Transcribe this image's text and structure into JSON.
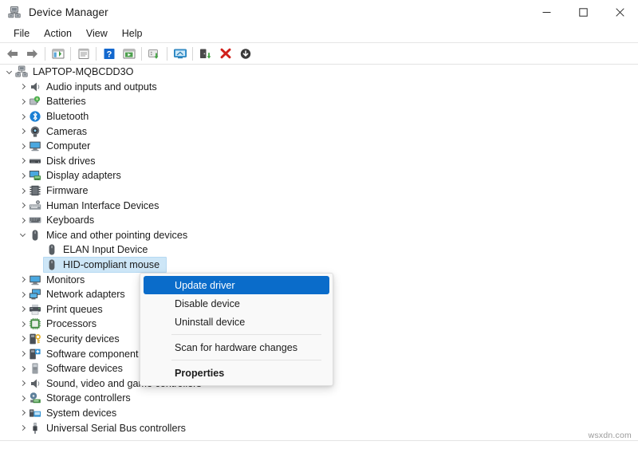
{
  "window": {
    "title": "Device Manager",
    "icon": "device-manager-icon",
    "minimize_label": "–",
    "maximize_label": "☐",
    "close_label": "✕"
  },
  "menubar": {
    "items": [
      {
        "label": "File"
      },
      {
        "label": "Action"
      },
      {
        "label": "View"
      },
      {
        "label": "Help"
      }
    ]
  },
  "toolbar": {
    "buttons": [
      {
        "name": "back-icon",
        "tooltip": "Back"
      },
      {
        "name": "forward-icon",
        "tooltip": "Forward"
      },
      {
        "name": "show-hide-console-tree-icon",
        "tooltip": "Show/Hide Console Tree"
      },
      {
        "name": "properties-icon",
        "tooltip": "Properties"
      },
      {
        "name": "help-icon",
        "tooltip": "Help"
      },
      {
        "name": "show-hide-action-pane-icon",
        "tooltip": "Show/Hide Action Pane"
      },
      {
        "name": "update-driver-icon",
        "tooltip": "Update Driver Software"
      },
      {
        "name": "scan-hardware-changes-icon",
        "tooltip": "Scan for hardware changes"
      },
      {
        "name": "enable-device-icon",
        "tooltip": "Enable device"
      },
      {
        "name": "uninstall-device-icon",
        "tooltip": "Uninstall device"
      },
      {
        "name": "disable-device-icon",
        "tooltip": "Disable device"
      }
    ]
  },
  "tree": {
    "root": {
      "label": "LAPTOP-MQBCDD3O",
      "icon": "computer-root-icon",
      "expanded": true
    },
    "nodes": [
      {
        "label": "Audio inputs and outputs",
        "icon": "speaker-icon",
        "expanded": false,
        "level": 1
      },
      {
        "label": "Batteries",
        "icon": "battery-icon",
        "expanded": false,
        "level": 1
      },
      {
        "label": "Bluetooth",
        "icon": "bluetooth-icon",
        "expanded": false,
        "level": 1
      },
      {
        "label": "Cameras",
        "icon": "camera-icon",
        "expanded": false,
        "level": 1
      },
      {
        "label": "Computer",
        "icon": "monitor-icon",
        "expanded": false,
        "level": 1
      },
      {
        "label": "Disk drives",
        "icon": "disk-drive-icon",
        "expanded": false,
        "level": 1
      },
      {
        "label": "Display adapters",
        "icon": "display-adapter-icon",
        "expanded": false,
        "level": 1
      },
      {
        "label": "Firmware",
        "icon": "firmware-chip-icon",
        "expanded": false,
        "level": 1
      },
      {
        "label": "Human Interface Devices",
        "icon": "hid-icon",
        "expanded": false,
        "level": 1
      },
      {
        "label": "Keyboards",
        "icon": "keyboard-icon",
        "expanded": false,
        "level": 1
      },
      {
        "label": "Mice and other pointing devices",
        "icon": "mouse-icon",
        "expanded": true,
        "level": 1
      },
      {
        "label": "ELAN Input Device",
        "icon": "mouse-icon",
        "expanded": null,
        "level": 2
      },
      {
        "label": "HID-compliant mouse",
        "icon": "mouse-icon",
        "expanded": null,
        "level": 2,
        "selected": true
      },
      {
        "label": "Monitors",
        "icon": "monitor-icon",
        "expanded": false,
        "level": 1
      },
      {
        "label": "Network adapters",
        "icon": "network-adapter-icon",
        "expanded": false,
        "level": 1
      },
      {
        "label": "Print queues",
        "icon": "printer-icon",
        "expanded": false,
        "level": 1
      },
      {
        "label": "Processors",
        "icon": "processor-icon",
        "expanded": false,
        "level": 1
      },
      {
        "label": "Security devices",
        "icon": "security-device-icon",
        "expanded": false,
        "level": 1
      },
      {
        "label": "Software component",
        "icon": "software-component-icon",
        "expanded": false,
        "level": 1
      },
      {
        "label": "Software devices",
        "icon": "software-device-icon",
        "expanded": false,
        "level": 1
      },
      {
        "label": "Sound, video and game controllers",
        "icon": "speaker-icon",
        "expanded": false,
        "level": 1
      },
      {
        "label": "Storage controllers",
        "icon": "storage-controller-icon",
        "expanded": false,
        "level": 1
      },
      {
        "label": "System devices",
        "icon": "system-device-icon",
        "expanded": false,
        "level": 1
      },
      {
        "label": "Universal Serial Bus controllers",
        "icon": "usb-icon",
        "expanded": false,
        "level": 1
      }
    ]
  },
  "context_menu": {
    "visible": true,
    "items": [
      {
        "label": "Update driver",
        "highlighted": true,
        "bold": false,
        "separator_after": false
      },
      {
        "label": "Disable device",
        "highlighted": false,
        "bold": false,
        "separator_after": false
      },
      {
        "label": "Uninstall device",
        "highlighted": false,
        "bold": false,
        "separator_after": true
      },
      {
        "label": "Scan for hardware changes",
        "highlighted": false,
        "bold": false,
        "separator_after": true
      },
      {
        "label": "Properties",
        "highlighted": false,
        "bold": true,
        "separator_after": false
      }
    ]
  },
  "watermark": {
    "text": "wsxdn.com"
  },
  "colors": {
    "menu_highlight": "#0a6cca",
    "tree_selection": "#cde6f7",
    "accent_blue": "#0078d4",
    "close_red": "#e81123"
  }
}
